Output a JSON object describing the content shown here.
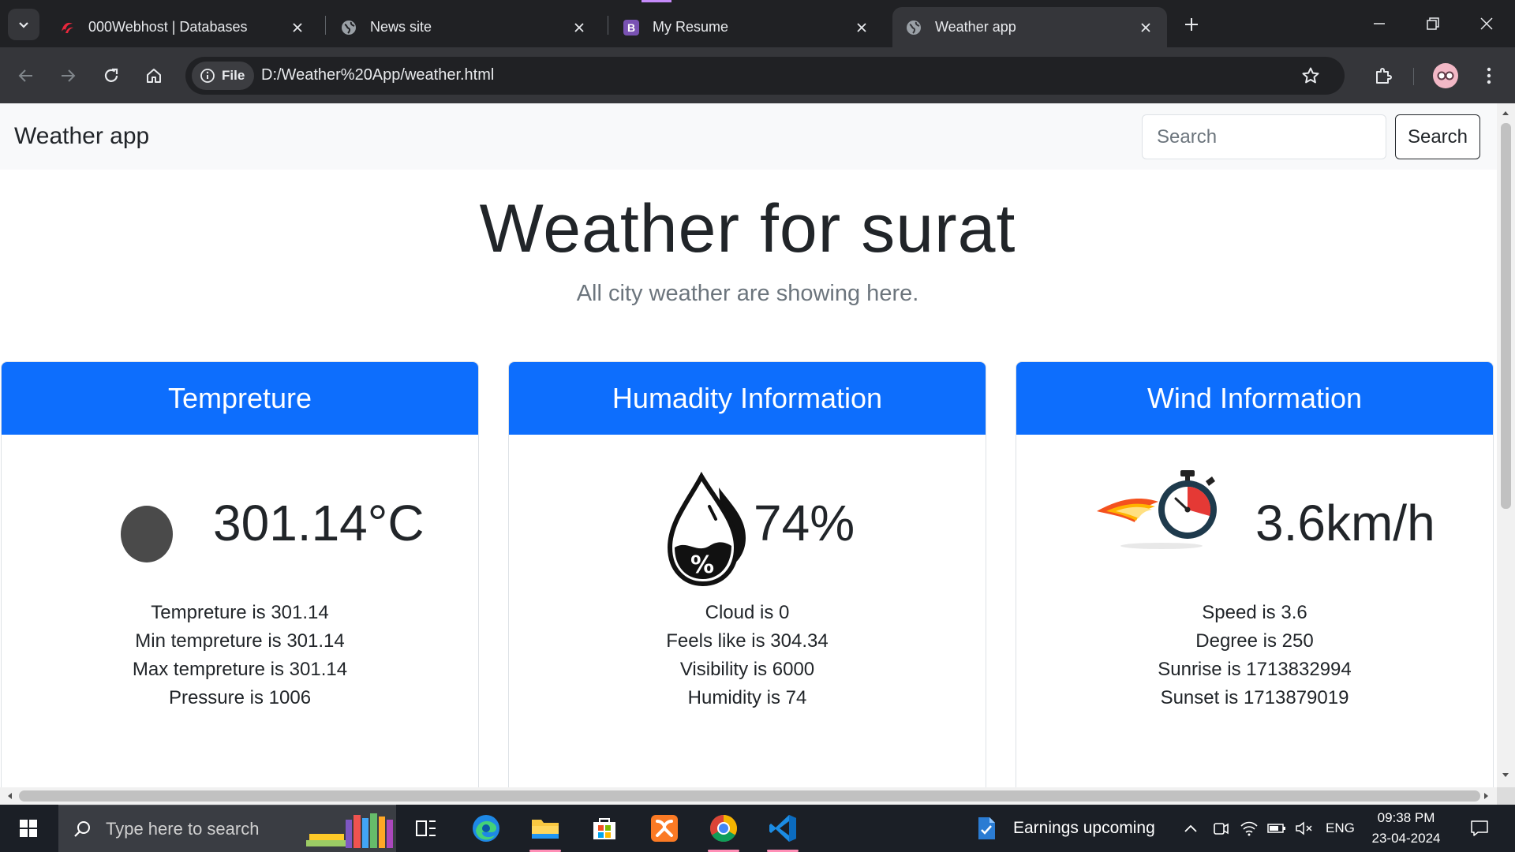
{
  "browser": {
    "tabs": [
      {
        "title": "000Webhost | Databases",
        "icon": "webhost-favicon"
      },
      {
        "title": "News site",
        "icon": "globe-favicon"
      },
      {
        "title": "My Resume",
        "icon": "bootstrap-favicon"
      },
      {
        "title": "Weather app",
        "icon": "globe-favicon",
        "active": true
      }
    ],
    "site_chip": "File",
    "url": "D:/Weather%20App/weather.html"
  },
  "navbar": {
    "brand": "Weather app",
    "search_placeholder": "Search",
    "search_button": "Search"
  },
  "heading": "Weather for surat",
  "subheading": "All city weather are showing here.",
  "cards": {
    "temperature": {
      "title": "Tempreture",
      "value": "301.14°C",
      "lines": [
        "Tempreture is 301.14",
        "Min tempreture is 301.14",
        "Max tempreture is 301.14",
        "Pressure is 1006"
      ]
    },
    "humidity": {
      "title": "Humadity Information",
      "value": "74%",
      "lines": [
        "Cloud is 0",
        "Feels like is 304.34",
        "Visibility is 6000",
        "Humidity is 74"
      ]
    },
    "wind": {
      "title": "Wind Information",
      "value": "3.6km/h",
      "lines": [
        "Speed is 3.6",
        "Degree is 250",
        "Sunrise is 1713832994",
        "Sunset is 1713879019"
      ]
    }
  },
  "taskbar": {
    "search_placeholder": "Type here to search",
    "widget_text": "Earnings upcoming",
    "language": "ENG",
    "time": "09:38 PM",
    "date": "23-04-2024"
  },
  "colors": {
    "card_header": "#0d6efd",
    "tab_bar": "#202124",
    "toolbar": "#35363a"
  }
}
